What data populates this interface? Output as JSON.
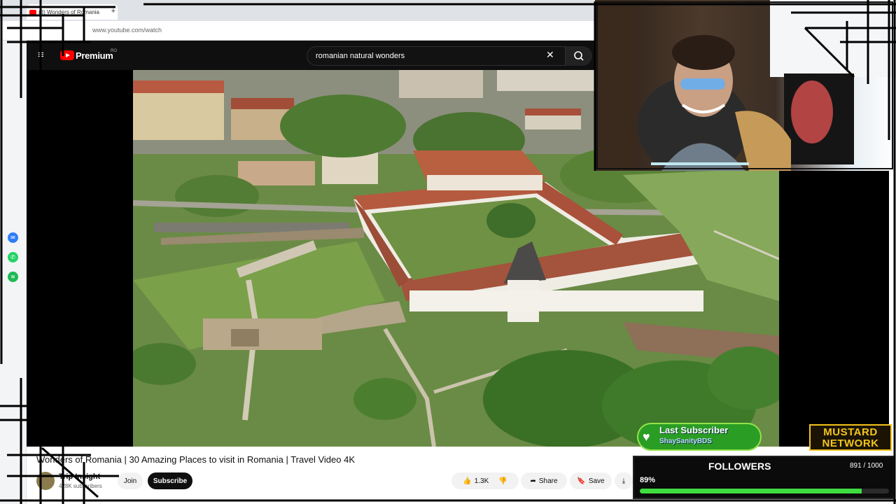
{
  "browser": {
    "tab_title": "(3) Wonders of Romania",
    "new_tab": "+",
    "url": "www.youtube.com/watch"
  },
  "youtube": {
    "logo_text": "Premium",
    "region": "RO",
    "search_query": "romanian natural wonders",
    "clear_icon": "✕"
  },
  "video": {
    "title": "Wonders of Romania | 30 Amazing Places to visit in Romania | Travel Video 4K",
    "channel": "Trip Insight",
    "subscribers": "428K subscribers",
    "join_label": "Join",
    "subscribe_label": "Subscribe",
    "likes": "1.3K",
    "share_label": "Share",
    "save_label": "Save"
  },
  "overlay": {
    "last_subscriber_title": "Last Subscriber",
    "last_subscriber_name": "ShaySanityBDS",
    "brand_line1": "MUSTARD",
    "brand_line2": "NETWORK",
    "followers_label": "FOLLOWERS",
    "followers_count": "891 / 1000",
    "followers_percent": "89%",
    "followers_progress": 0.89
  },
  "sidebar_icons": [
    "messenger-icon",
    "whatsapp-icon",
    "spotify-icon"
  ],
  "colors": {
    "youtube_red": "#ff0000",
    "accent_green": "#3fdc3f",
    "mustard": "#f2c21a"
  }
}
